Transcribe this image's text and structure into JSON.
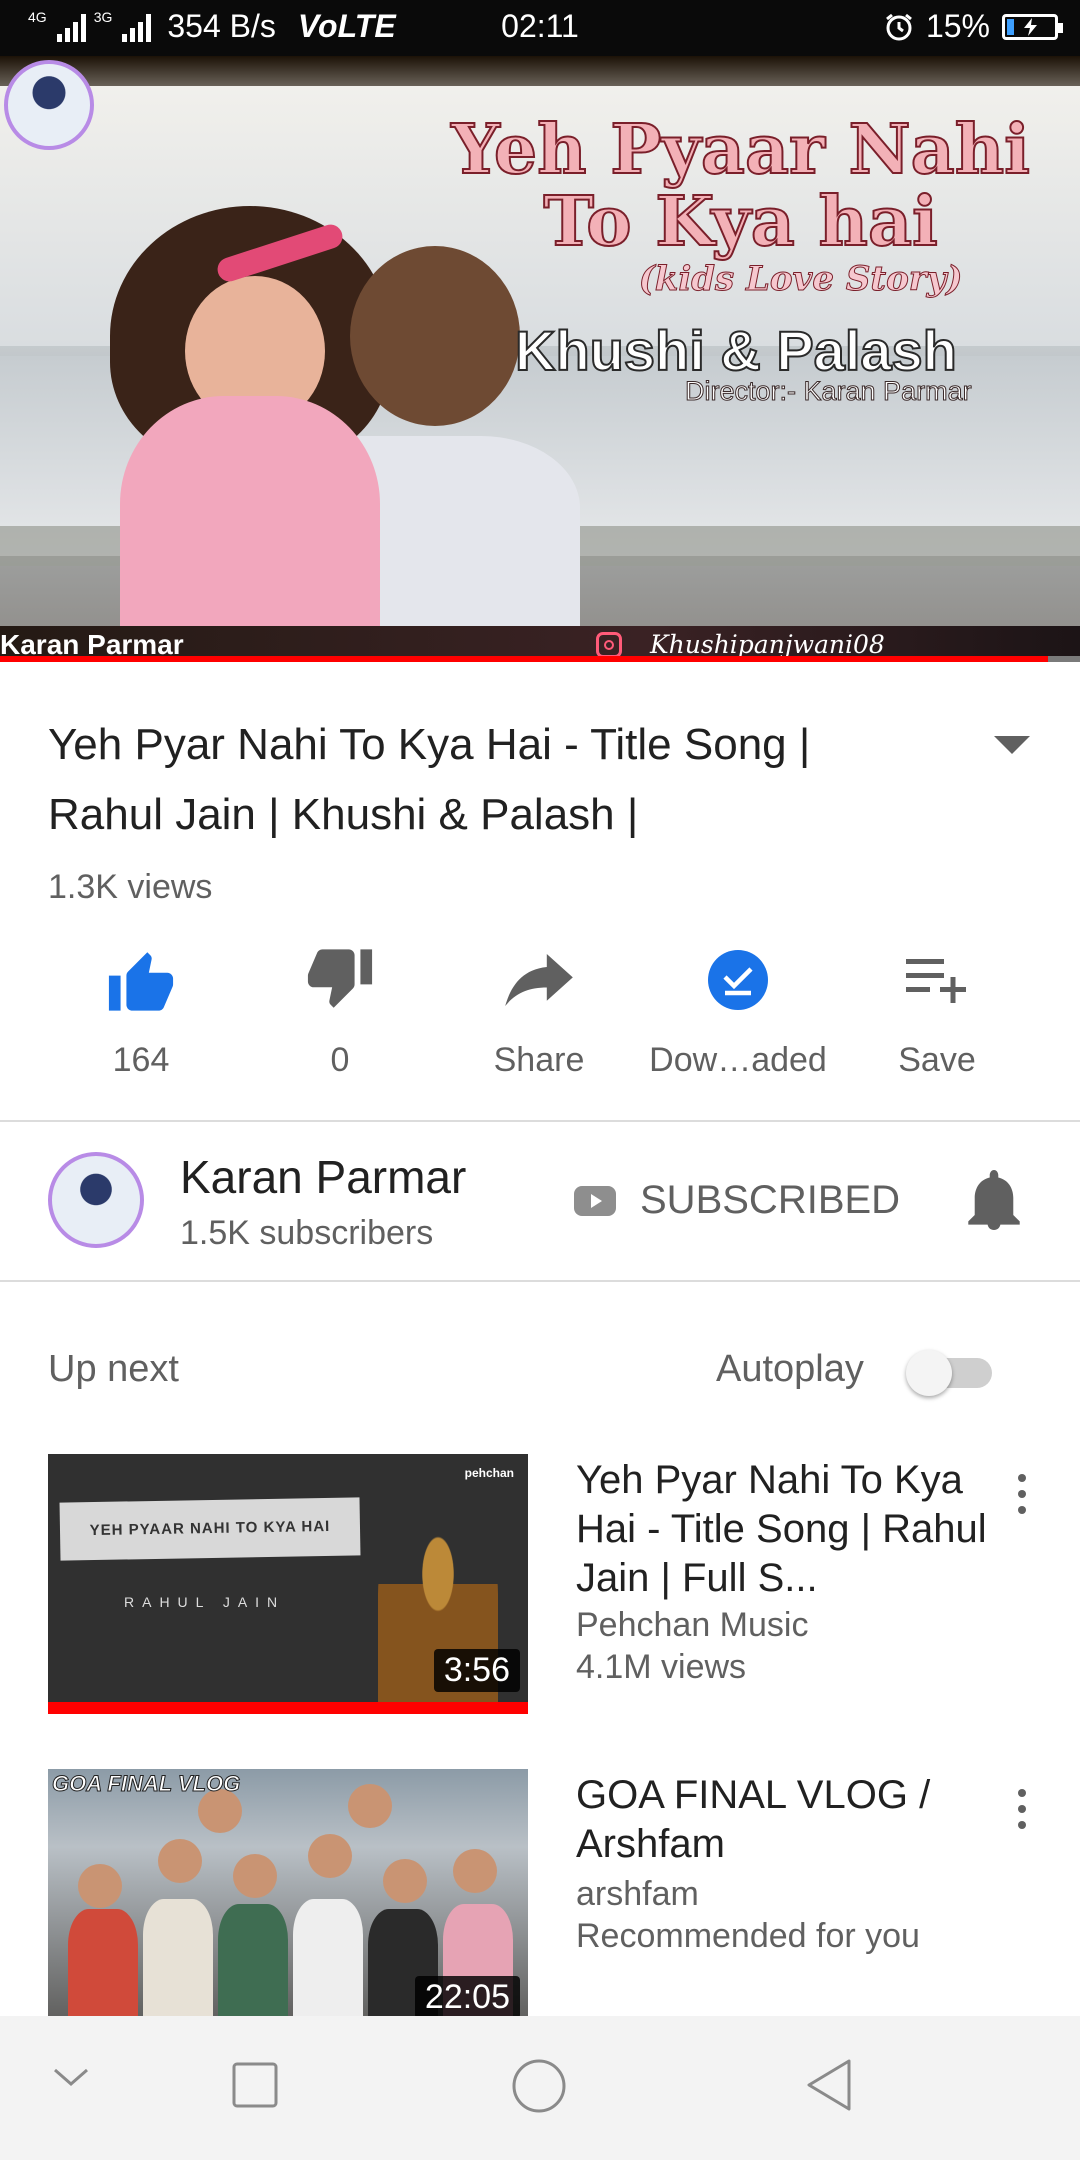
{
  "status_bar": {
    "network_label": "4G",
    "network_label2": "3G",
    "data_rate": "354 B/s",
    "volte": "VoLTE",
    "time": "02:11",
    "battery": "15%",
    "battery_level": 0.15,
    "icons": [
      "signal-icon",
      "alarm-icon",
      "battery-icon"
    ]
  },
  "player": {
    "thumbnail_text": {
      "title_line1": "Yeh Pyaar Nahi",
      "title_line2": "To Kya hai",
      "tagline": "(kids Love Story)",
      "names": "Khushi & Palash",
      "director": "Director:- Karan Parmar",
      "credit_left": "Karan Parmar",
      "credit_right": "Khushipanjwani08"
    },
    "progress": 0.97,
    "progress_color": "#ff0000"
  },
  "video": {
    "title": "Yeh Pyar Nahi To Kya Hai - Title Song | Rahul Jain | Khushi & Palash |",
    "views": "1.3K views"
  },
  "actions": {
    "like": "164",
    "dislike": "0",
    "share": "Share",
    "download": "Dow…aded",
    "save": "Save"
  },
  "channel": {
    "name": "Karan Parmar",
    "subscribers": "1.5K subscribers",
    "subscribe_state": "SUBSCRIBED"
  },
  "up_next": {
    "label": "Up next",
    "autoplay_label": "Autoplay",
    "autoplay_on": false
  },
  "videos": [
    {
      "title": "Yeh Pyar Nahi To Kya Hai - Title Song | Rahul Jain | Full S...",
      "channel": "Pehchan Music",
      "meta": "4.1M views",
      "duration": "3:56",
      "thumb_text": "YEH PYAAR NAHI TO KYA HAI",
      "thumb_artist": "RAHUL JAIN",
      "thumb_logo": "pehchan"
    },
    {
      "title": "GOA FINAL VLOG / Arshfam",
      "channel": "arshfam",
      "meta": "Recommended for you",
      "duration": "22:05",
      "thumb_text": "GOA FINAL VLOG"
    }
  ],
  "colors": {
    "accent_blue": "#1a73e8",
    "youtube_red": "#ff0000",
    "text_primary": "#212121",
    "text_secondary": "#606060"
  }
}
